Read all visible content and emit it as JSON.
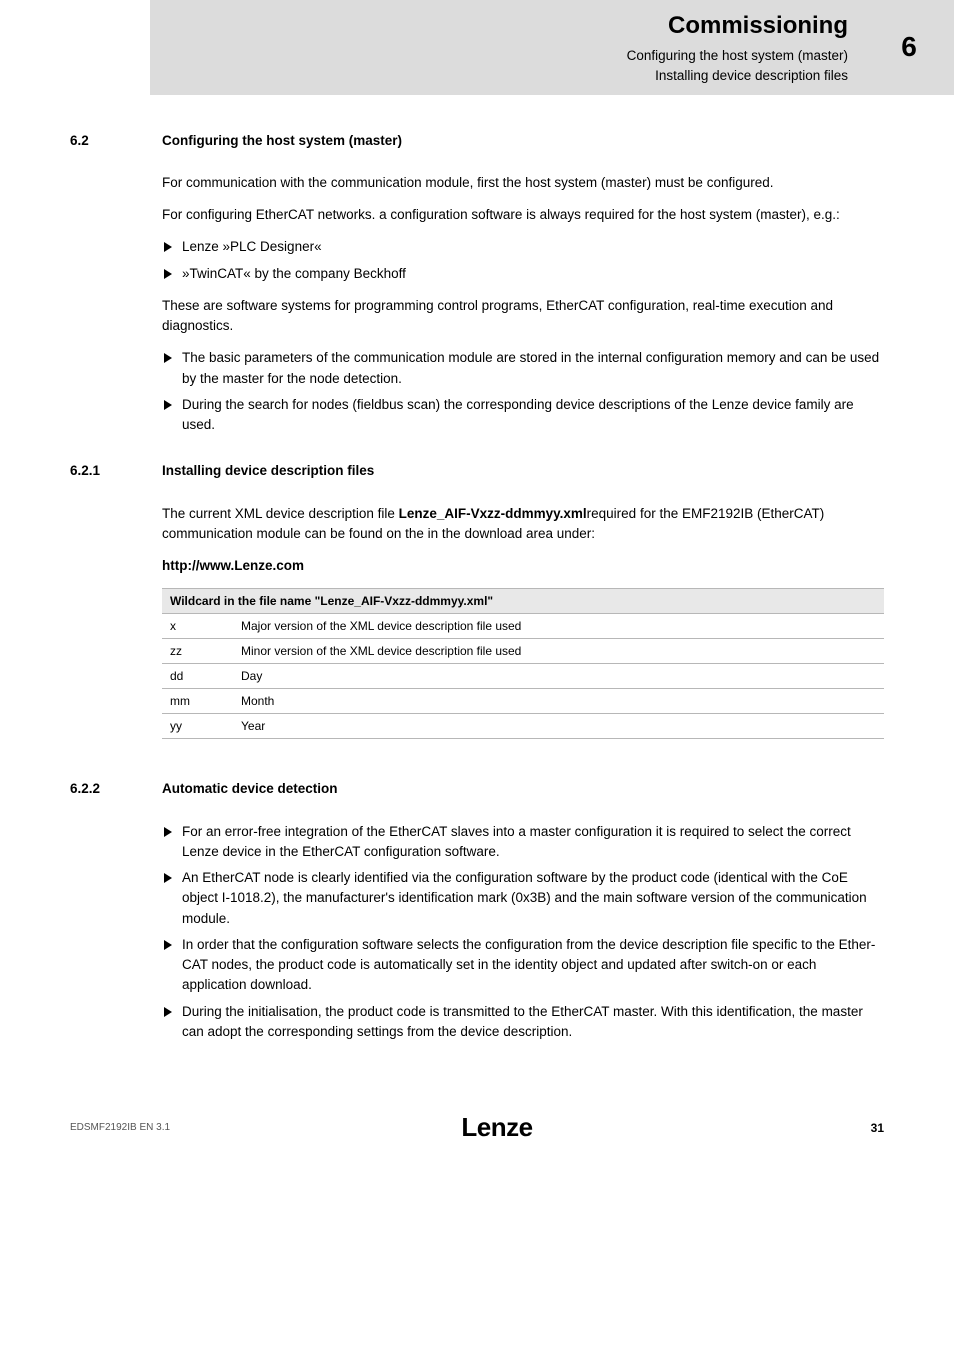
{
  "header": {
    "title": "Commissioning",
    "sub1": "Configuring the host system (master)",
    "sub2": "Installing device description files",
    "chapter": "6"
  },
  "s62": {
    "num": "6.2",
    "heading": "Configuring the host system (master)",
    "p1": "For communication with the communication module, first the host system (master) must be configured.",
    "p2": "For configuring EtherCAT networks. a configuration software is always required for the host system (master), e.g.:",
    "b1": "Lenze »PLC Designer«",
    "b2": "»TwinCAT« by the company Beckhoff",
    "p3": "These are software systems for programming control programs, EtherCAT configuration, real-time execution and diagnostics.",
    "b3": "The basic parameters of the communication module are stored in the internal configuration memory and can be used by the master for the node detection.",
    "b4": "During the search for nodes (fieldbus scan) the corresponding device descriptions of the Lenze device family are used."
  },
  "s621": {
    "num": "6.2.1",
    "heading": "Installing device description files",
    "p1a": "The current XML device description file ",
    "p1b": "Lenze_AIF-Vxzz-ddmmyy.xml",
    "p1c": "required for the EMF2192IB (EtherCAT) communication module can be found on the in the download area under:",
    "url": "http://www.Lenze.com"
  },
  "table": {
    "header": "Wildcard in the file name \"Lenze_AIF-Vxzz-ddmmyy.xml\"",
    "rows": [
      {
        "k": "x",
        "v": "Major version of the XML device description file used"
      },
      {
        "k": "zz",
        "v": "Minor version of the XML device description file used"
      },
      {
        "k": "dd",
        "v": "Day"
      },
      {
        "k": "mm",
        "v": "Month"
      },
      {
        "k": "yy",
        "v": "Year"
      }
    ]
  },
  "s622": {
    "num": "6.2.2",
    "heading": "Automatic device detection",
    "b1": "For an error-free integration of the EtherCAT slaves into a master configuration it is required to select the correct Lenze device in the EtherCAT configuration software.",
    "b2": "An EtherCAT node is clearly identified via the configuration software by the product code (identical with the CoE object I-1018.2), the manufacturer's identification mark (0x3B) and the main software version of the communication module.",
    "b3": "In order that the configuration software selects the configuration from the device description file specific to the Ether-CAT nodes, the product code is automatically set in the identity object and updated after switch-on or each application download.",
    "b4": "During the initialisation, the product code is transmitted to the EtherCAT master. With this identification, the master can adopt the corresponding settings from the device description."
  },
  "footer": {
    "left": "EDSMF2192IB  EN  3.1",
    "logo": "Lenze",
    "page": "31"
  }
}
